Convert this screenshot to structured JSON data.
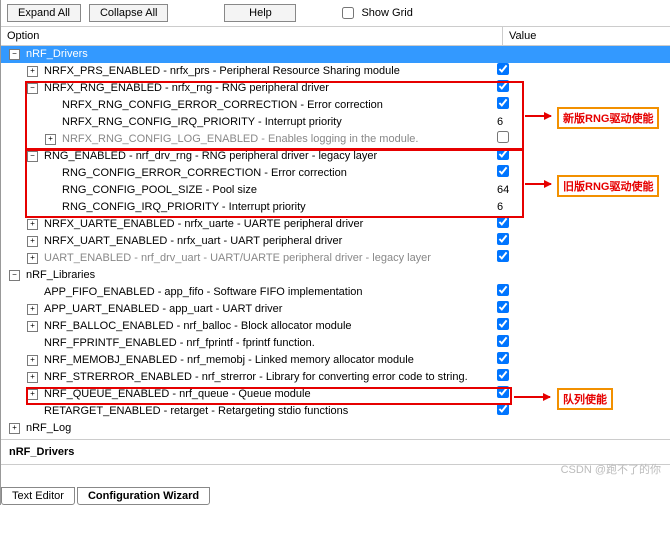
{
  "toolbar": {
    "expand": "Expand All",
    "collapse": "Collapse All",
    "help": "Help",
    "showgrid": "Show Grid"
  },
  "cols": {
    "option": "Option",
    "value": "Value"
  },
  "rows": [
    {
      "d": 0,
      "t": "-",
      "lbl": "nRF_Drivers",
      "sel": true
    },
    {
      "d": 1,
      "t": "+",
      "lbl": "NRFX_PRS_ENABLED - nrfx_prs - Peripheral Resource Sharing module",
      "chk": true
    },
    {
      "d": 1,
      "t": "-",
      "lbl": "NRFX_RNG_ENABLED - nrfx_rng - RNG peripheral driver",
      "chk": true
    },
    {
      "d": 2,
      "t": "",
      "lbl": "NRFX_RNG_CONFIG_ERROR_CORRECTION  - Error correction",
      "chk": true
    },
    {
      "d": 2,
      "t": "",
      "lbl": "NRFX_RNG_CONFIG_IRQ_PRIORITY  - Interrupt priority",
      "val": "6"
    },
    {
      "d": 2,
      "t": "+",
      "lbl": "NRFX_RNG_CONFIG_LOG_ENABLED - Enables logging in the module.",
      "chk": false,
      "gray": true
    },
    {
      "d": 1,
      "t": "-",
      "lbl": "RNG_ENABLED - nrf_drv_rng - RNG peripheral driver - legacy layer",
      "chk": true
    },
    {
      "d": 2,
      "t": "",
      "lbl": "RNG_CONFIG_ERROR_CORRECTION  - Error correction",
      "chk": true
    },
    {
      "d": 2,
      "t": "",
      "lbl": "RNG_CONFIG_POOL_SIZE - Pool size",
      "val": "64"
    },
    {
      "d": 2,
      "t": "",
      "lbl": "RNG_CONFIG_IRQ_PRIORITY  - Interrupt priority",
      "val": "6"
    },
    {
      "d": 1,
      "t": "+",
      "lbl": "NRFX_UARTE_ENABLED - nrfx_uarte - UARTE peripheral driver",
      "chk": true
    },
    {
      "d": 1,
      "t": "+",
      "lbl": "NRFX_UART_ENABLED - nrfx_uart - UART peripheral driver",
      "chk": true
    },
    {
      "d": 1,
      "t": "+",
      "lbl": "UART_ENABLED - nrf_drv_uart - UART/UARTE peripheral driver - legacy layer",
      "chk": true,
      "gray": true
    },
    {
      "d": 0,
      "t": "-",
      "lbl": "nRF_Libraries"
    },
    {
      "d": 1,
      "t": "",
      "lbl": "APP_FIFO_ENABLED  - app_fifo - Software FIFO implementation",
      "chk": true
    },
    {
      "d": 1,
      "t": "+",
      "lbl": "APP_UART_ENABLED - app_uart - UART driver",
      "chk": true
    },
    {
      "d": 1,
      "t": "+",
      "lbl": "NRF_BALLOC_ENABLED - nrf_balloc - Block allocator module",
      "chk": true
    },
    {
      "d": 1,
      "t": "",
      "lbl": "NRF_FPRINTF_ENABLED  - nrf_fprintf - fprintf function.",
      "chk": true
    },
    {
      "d": 1,
      "t": "+",
      "lbl": "NRF_MEMOBJ_ENABLED - nrf_memobj - Linked memory allocator module",
      "chk": true
    },
    {
      "d": 1,
      "t": "+",
      "lbl": "NRF_STRERROR_ENABLED  - nrf_strerror - Library for converting error code to string.",
      "chk": true
    },
    {
      "d": 1,
      "t": "+",
      "lbl": "NRF_QUEUE_ENABLED - nrf_queue - Queue module",
      "chk": true
    },
    {
      "d": 1,
      "t": "",
      "lbl": "RETARGET_ENABLED  - retarget - Retargeting stdio functions",
      "chk": true
    },
    {
      "d": 0,
      "t": "+",
      "lbl": "nRF_Log"
    }
  ],
  "selected_footer": "nRF_Drivers",
  "annots": {
    "a1": "新版RNG驱动使能",
    "a2": "旧版RNG驱动使能",
    "a3": "队列使能"
  },
  "tabs": {
    "t1": "Text Editor",
    "t2": "Configuration Wizard"
  },
  "watermark": "CSDN @跑不了的你"
}
